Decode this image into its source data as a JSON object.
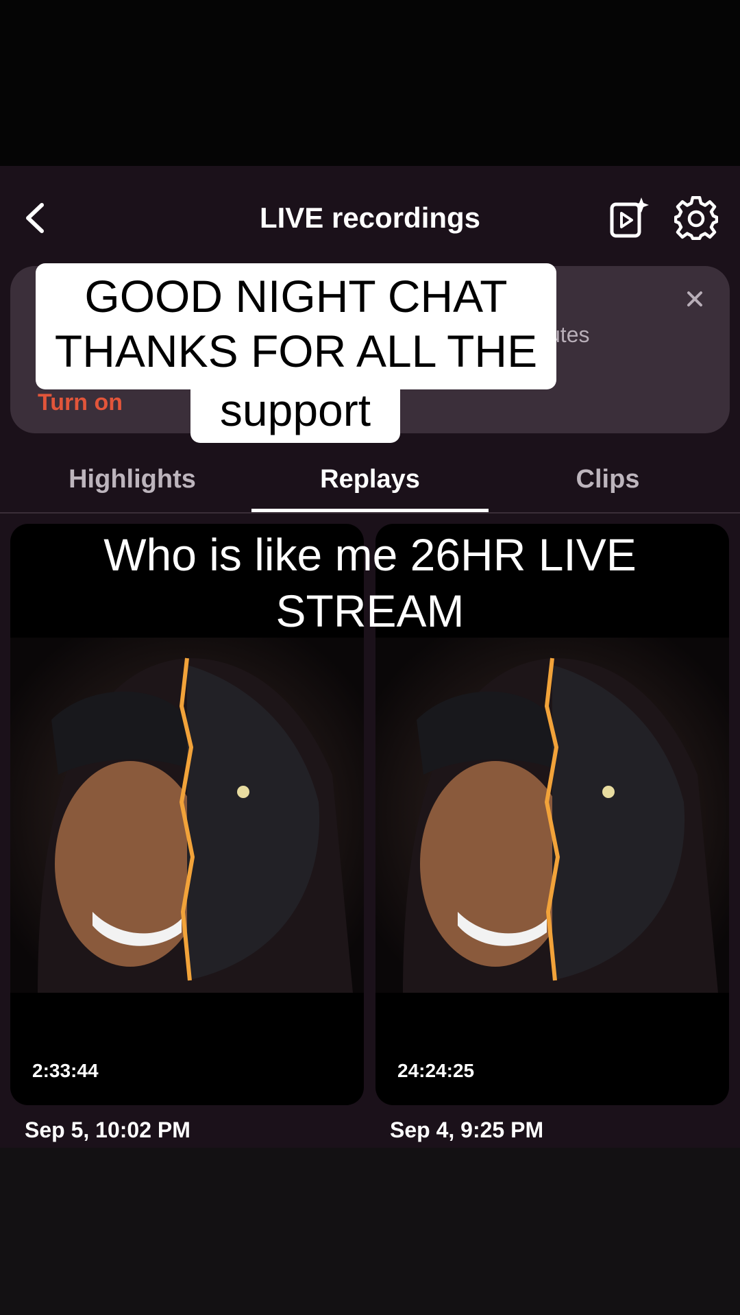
{
  "header": {
    "title": "LIVE recordings"
  },
  "banner": {
    "partial_text": "utes",
    "action_label": "Turn on"
  },
  "overlay": {
    "line1": "GOOD NIGHT CHAT",
    "line2": "THANKS FOR ALL THE",
    "line3": "support"
  },
  "tabs": [
    {
      "label": "Highlights",
      "active": false
    },
    {
      "label": "Replays",
      "active": true
    },
    {
      "label": "Clips",
      "active": false
    }
  ],
  "caption": {
    "line1": "Who is like me 26HR LIVE",
    "line2": "STREAM"
  },
  "replays": [
    {
      "duration": "2:33:44",
      "date": "Sep 5, 10:02 PM"
    },
    {
      "duration": "24:24:25",
      "date": "Sep 4, 9:25 PM"
    }
  ],
  "colors": {
    "accent": "#e2553a",
    "screen_bg": "#1b111a",
    "banner_bg": "#3b2f3a"
  }
}
